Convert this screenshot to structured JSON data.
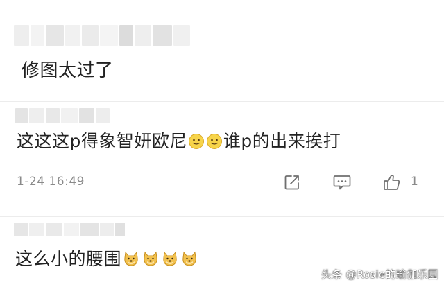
{
  "comments": [
    {
      "text": "修图太过了"
    },
    {
      "text_before_emoji": "这这这p得象智妍欧尼",
      "text_after_emoji": "谁p的出来挨打",
      "timestamp": "1-24 16:49",
      "like_count": "1"
    },
    {
      "text": "这么小的腰围"
    }
  ],
  "watermark": "头条 @Rosie的瑜伽乐园",
  "icons": [
    "share-icon",
    "reply-icon",
    "thumbs-up-icon",
    "slightly-smiling-face-emoji",
    "dog-face-emoji"
  ],
  "colors": {
    "text": "#222222",
    "meta": "#8a8a8a",
    "divider": "#ececec",
    "emoji_yellow": "#f7d44a"
  }
}
